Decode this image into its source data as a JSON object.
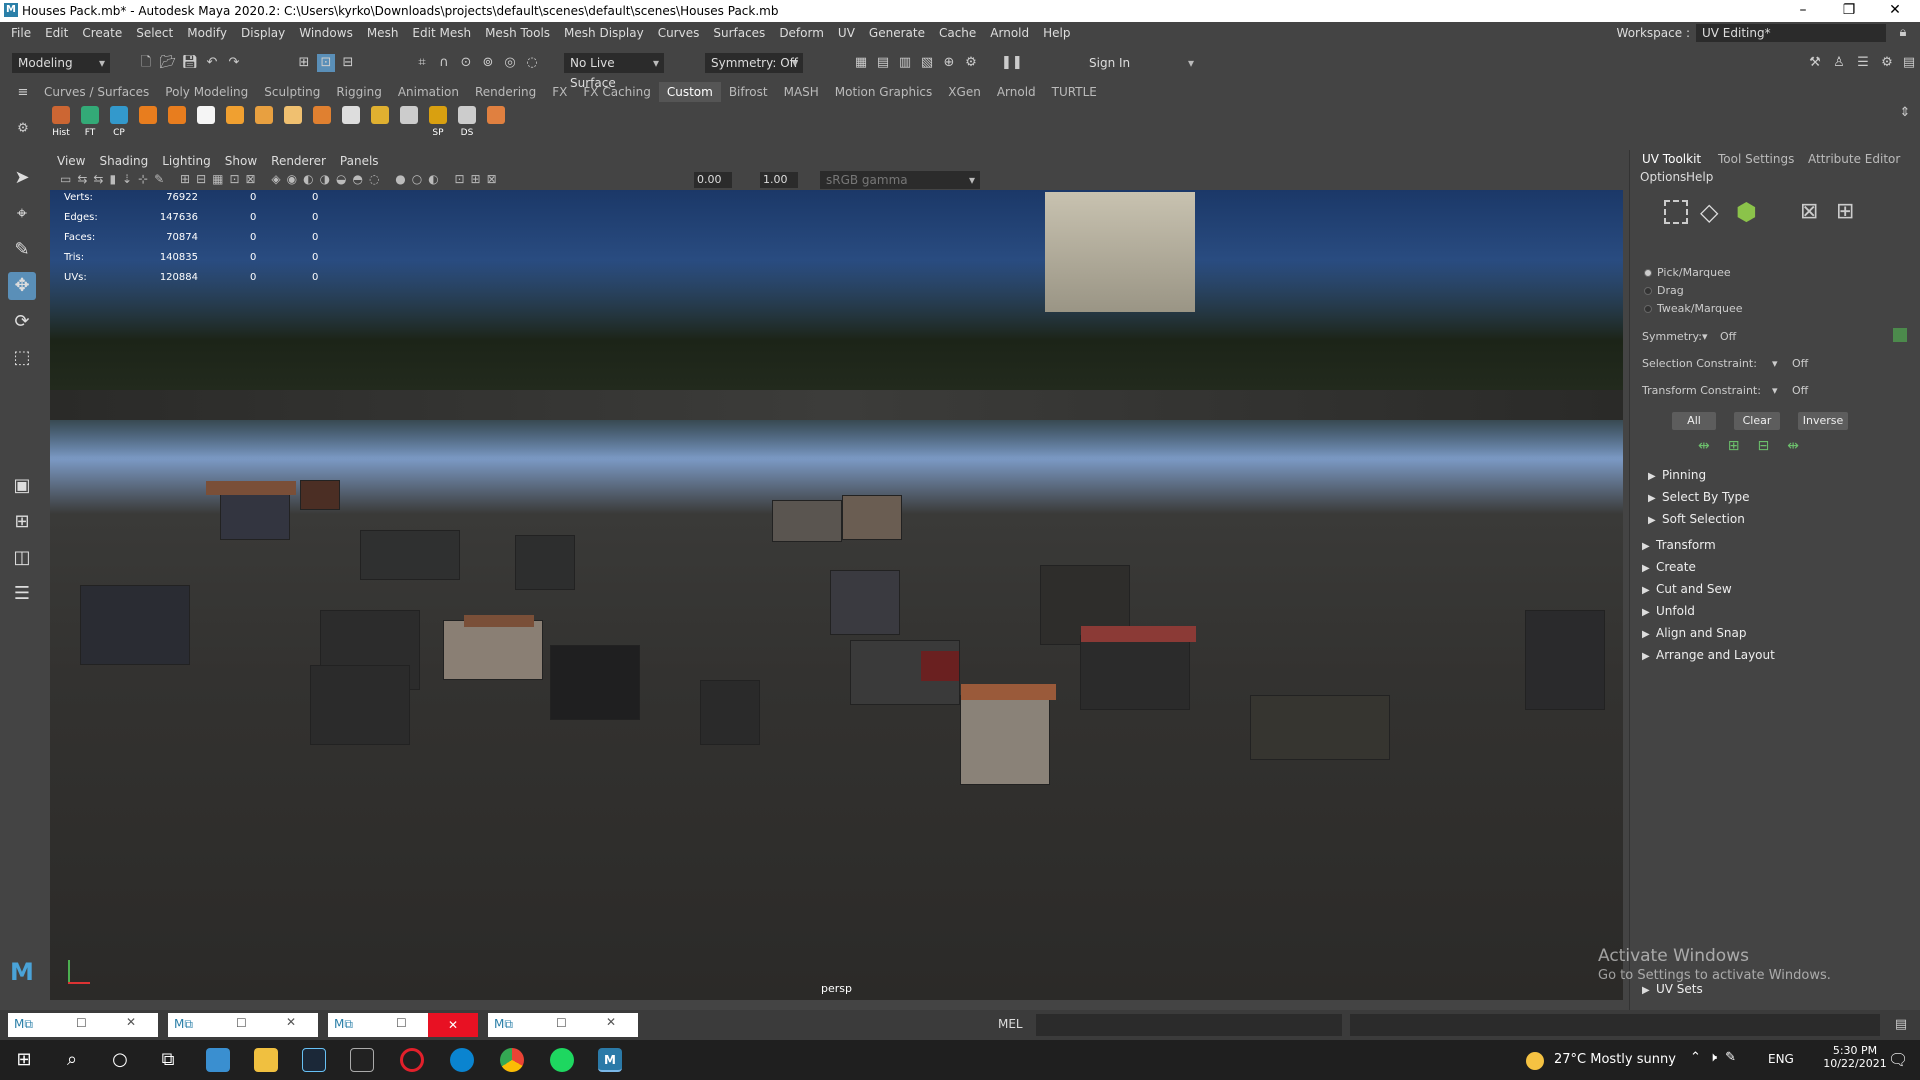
{
  "window": {
    "title": "Houses Pack.mb* - Autodesk Maya 2020.2: C:\\Users\\kyrko\\Downloads\\projects\\default\\scenes\\default\\scenes\\Houses Pack.mb",
    "logo": "M"
  },
  "menubar": {
    "items": [
      "File",
      "Edit",
      "Create",
      "Select",
      "Modify",
      "Display",
      "Windows",
      "Mesh",
      "Edit Mesh",
      "Mesh Tools",
      "Mesh Display",
      "Curves",
      "Surfaces",
      "Deform",
      "UV",
      "Generate",
      "Cache",
      "Arnold",
      "Help"
    ],
    "workspace_label": "Workspace :",
    "workspace_value": "UV Editing*"
  },
  "statusline": {
    "mode": "Modeling",
    "live_surface": "No Live Surface",
    "symmetry": "Symmetry: Off",
    "sign_in": "Sign In"
  },
  "shelf": {
    "tabs": [
      "Curves / Surfaces",
      "Poly Modeling",
      "Sculpting",
      "Rigging",
      "Animation",
      "Rendering",
      "FX",
      "FX Caching",
      "Custom",
      "Bifrost",
      "MASH",
      "Motion Graphics",
      "XGen",
      "Arnold",
      "TURTLE"
    ],
    "active_tab": "Custom",
    "buttons": [
      "Hist",
      "FT",
      "CP",
      "",
      "",
      "",
      "",
      "",
      "",
      "",
      "",
      "",
      "",
      "SP",
      "DS",
      ""
    ]
  },
  "viewport": {
    "menus": [
      "View",
      "Shading",
      "Lighting",
      "Show",
      "Renderer",
      "Panels"
    ],
    "field_a": "0.00",
    "field_b": "1.00",
    "color_space": "sRGB gamma",
    "camera": "persp",
    "hud": [
      {
        "label": "Verts:",
        "v1": "76922",
        "v2": "0",
        "v3": "0"
      },
      {
        "label": "Edges:",
        "v1": "147636",
        "v2": "0",
        "v3": "0"
      },
      {
        "label": "Faces:",
        "v1": "70874",
        "v2": "0",
        "v3": "0"
      },
      {
        "label": "Tris:",
        "v1": "140835",
        "v2": "0",
        "v3": "0"
      },
      {
        "label": "UVs:",
        "v1": "120884",
        "v2": "0",
        "v3": "0"
      }
    ]
  },
  "rpanel": {
    "tabs": [
      "UV Toolkit",
      "Tool Settings",
      "Attribute Editor"
    ],
    "submenu": [
      "Options",
      "Help"
    ],
    "modes": [
      "Pick/Marquee",
      "Drag",
      "Tweak/Marquee"
    ],
    "symmetry_label": "Symmetry:",
    "symmetry_value": "Off",
    "sel_constraint_label": "Selection Constraint:",
    "sel_constraint_value": "Off",
    "xf_constraint_label": "Transform Constraint:",
    "xf_constraint_value": "Off",
    "btn_all": "All",
    "btn_clear": "Clear",
    "btn_inverse": "Inverse",
    "sections_sub": [
      "Pinning",
      "Select By Type",
      "Soft Selection"
    ],
    "sections": [
      "Transform",
      "Create",
      "Cut and Sew",
      "Unfold",
      "Align and Snap",
      "Arrange and Layout"
    ],
    "uv_sets": "UV Sets"
  },
  "bottom": {
    "mel_label": "MEL"
  },
  "watermark": {
    "line1": "Activate Windows",
    "line2": "Go to Settings to activate Windows."
  },
  "taskbar": {
    "weather": "27°C  Mostly sunny",
    "lang": "ENG",
    "time": "5:30 PM",
    "date": "10/22/2021"
  }
}
